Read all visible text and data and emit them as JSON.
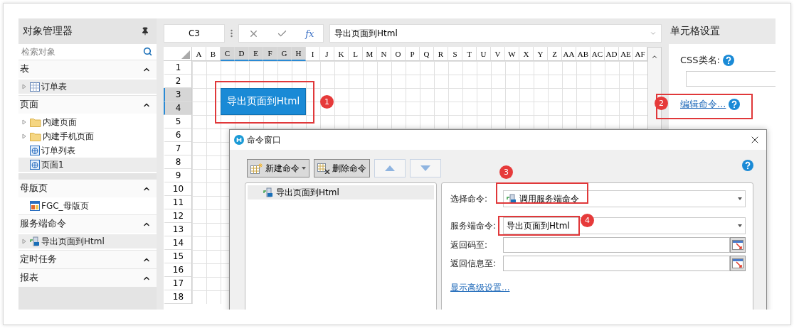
{
  "object_manager": {
    "title": "对象管理器",
    "search": {
      "placeholder": "检索对象"
    },
    "sections": [
      {
        "title": "表",
        "expanded": true,
        "items": [
          {
            "label": "订单表",
            "kind": "table",
            "expandable": true,
            "selected": true
          }
        ]
      },
      {
        "title": "页面",
        "expanded": true,
        "items": [
          {
            "label": "内建页面",
            "kind": "folder",
            "expandable": true,
            "selected": false
          },
          {
            "label": "内建手机页面",
            "kind": "folder",
            "expandable": true,
            "selected": false
          },
          {
            "label": "订单列表",
            "kind": "page",
            "expandable": false,
            "selected": false
          },
          {
            "label": "页面1",
            "kind": "page",
            "expandable": false,
            "selected": true
          }
        ]
      },
      {
        "title": "母版页",
        "expanded": true,
        "items": [
          {
            "label": "FGC_母版页",
            "kind": "master",
            "expandable": false,
            "selected": false
          }
        ]
      },
      {
        "title": "服务端命令",
        "expanded": true,
        "items": [
          {
            "label": "导出页面到Html",
            "kind": "command",
            "expandable": true,
            "selected": true
          }
        ]
      },
      {
        "title": "定时任务",
        "expanded": true
      },
      {
        "title": "报表",
        "expanded": true
      }
    ]
  },
  "formula_bar": {
    "cell_ref": "C3",
    "function_label": "fx",
    "formula": "导出页面到Html"
  },
  "grid": {
    "columns": [
      {
        "label": "A",
        "selected": false
      },
      {
        "label": "B",
        "selected": false
      },
      {
        "label": "C",
        "selected": true
      },
      {
        "label": "D",
        "selected": true
      },
      {
        "label": "E",
        "selected": true
      },
      {
        "label": "F",
        "selected": true
      },
      {
        "label": "G",
        "selected": true
      },
      {
        "label": "H",
        "selected": true
      },
      {
        "label": "I",
        "selected": false
      },
      {
        "label": "J",
        "selected": false
      },
      {
        "label": "K",
        "selected": false
      },
      {
        "label": "L",
        "selected": false
      },
      {
        "label": "M",
        "selected": false
      },
      {
        "label": "N",
        "selected": false
      },
      {
        "label": "O",
        "selected": false
      },
      {
        "label": "P",
        "selected": false
      },
      {
        "label": "Q",
        "selected": false
      },
      {
        "label": "R",
        "selected": false
      },
      {
        "label": "S",
        "selected": false
      },
      {
        "label": "T",
        "selected": false
      },
      {
        "label": "U",
        "selected": false
      },
      {
        "label": "V",
        "selected": false
      },
      {
        "label": "W",
        "selected": false
      },
      {
        "label": "X",
        "selected": false
      },
      {
        "label": "Y",
        "selected": false
      },
      {
        "label": "Z",
        "selected": false
      },
      {
        "label": "AA",
        "selected": false
      },
      {
        "label": "AB",
        "selected": false
      },
      {
        "label": "AC",
        "selected": false
      },
      {
        "label": "AD",
        "selected": false
      },
      {
        "label": "AE",
        "selected": false
      },
      {
        "label": "AF",
        "selected": false
      }
    ],
    "rows": [
      {
        "label": "1",
        "selected": false
      },
      {
        "label": "2",
        "selected": false
      },
      {
        "label": "3",
        "selected": true
      },
      {
        "label": "4",
        "selected": true
      },
      {
        "label": "5",
        "selected": false
      },
      {
        "label": "6",
        "selected": false
      },
      {
        "label": "7",
        "selected": false
      },
      {
        "label": "8",
        "selected": false
      },
      {
        "label": "9",
        "selected": false
      },
      {
        "label": "10",
        "selected": false
      },
      {
        "label": "11",
        "selected": false
      },
      {
        "label": "12",
        "selected": false
      },
      {
        "label": "13",
        "selected": false
      },
      {
        "label": "14",
        "selected": false
      },
      {
        "label": "15",
        "selected": false
      },
      {
        "label": "16",
        "selected": false
      },
      {
        "label": "17",
        "selected": false
      },
      {
        "label": "18",
        "selected": false
      }
    ],
    "button": {
      "label": "导出页面到Html"
    }
  },
  "cell_settings": {
    "title": "单元格设置",
    "css_label": "CSS类名:",
    "edit_command_link": "编辑命令..."
  },
  "dialog": {
    "title": "命令窗口",
    "toolbar": [
      {
        "kind": "dropdown",
        "label": "新建命令"
      },
      {
        "kind": "delete",
        "label": "删除命令"
      },
      {
        "kind": "up"
      },
      {
        "kind": "down"
      }
    ],
    "commands": [
      {
        "label": "导出页面到Html",
        "selected": true
      }
    ],
    "fields": [
      {
        "kind": "select",
        "label": "选择命令:",
        "value": "调用服务端命令",
        "icon": true
      },
      {
        "kind": "select",
        "label": "服务端命令:",
        "value": "导出页面到Html",
        "icon": false
      },
      {
        "kind": "picker",
        "label": "返回码至:"
      },
      {
        "kind": "picker",
        "label": "返回信息至:"
      }
    ],
    "advanced_link": "显示高级设置..."
  },
  "annotations": [
    {
      "label": "1"
    },
    {
      "label": "2"
    },
    {
      "label": "3"
    },
    {
      "label": "4"
    }
  ]
}
